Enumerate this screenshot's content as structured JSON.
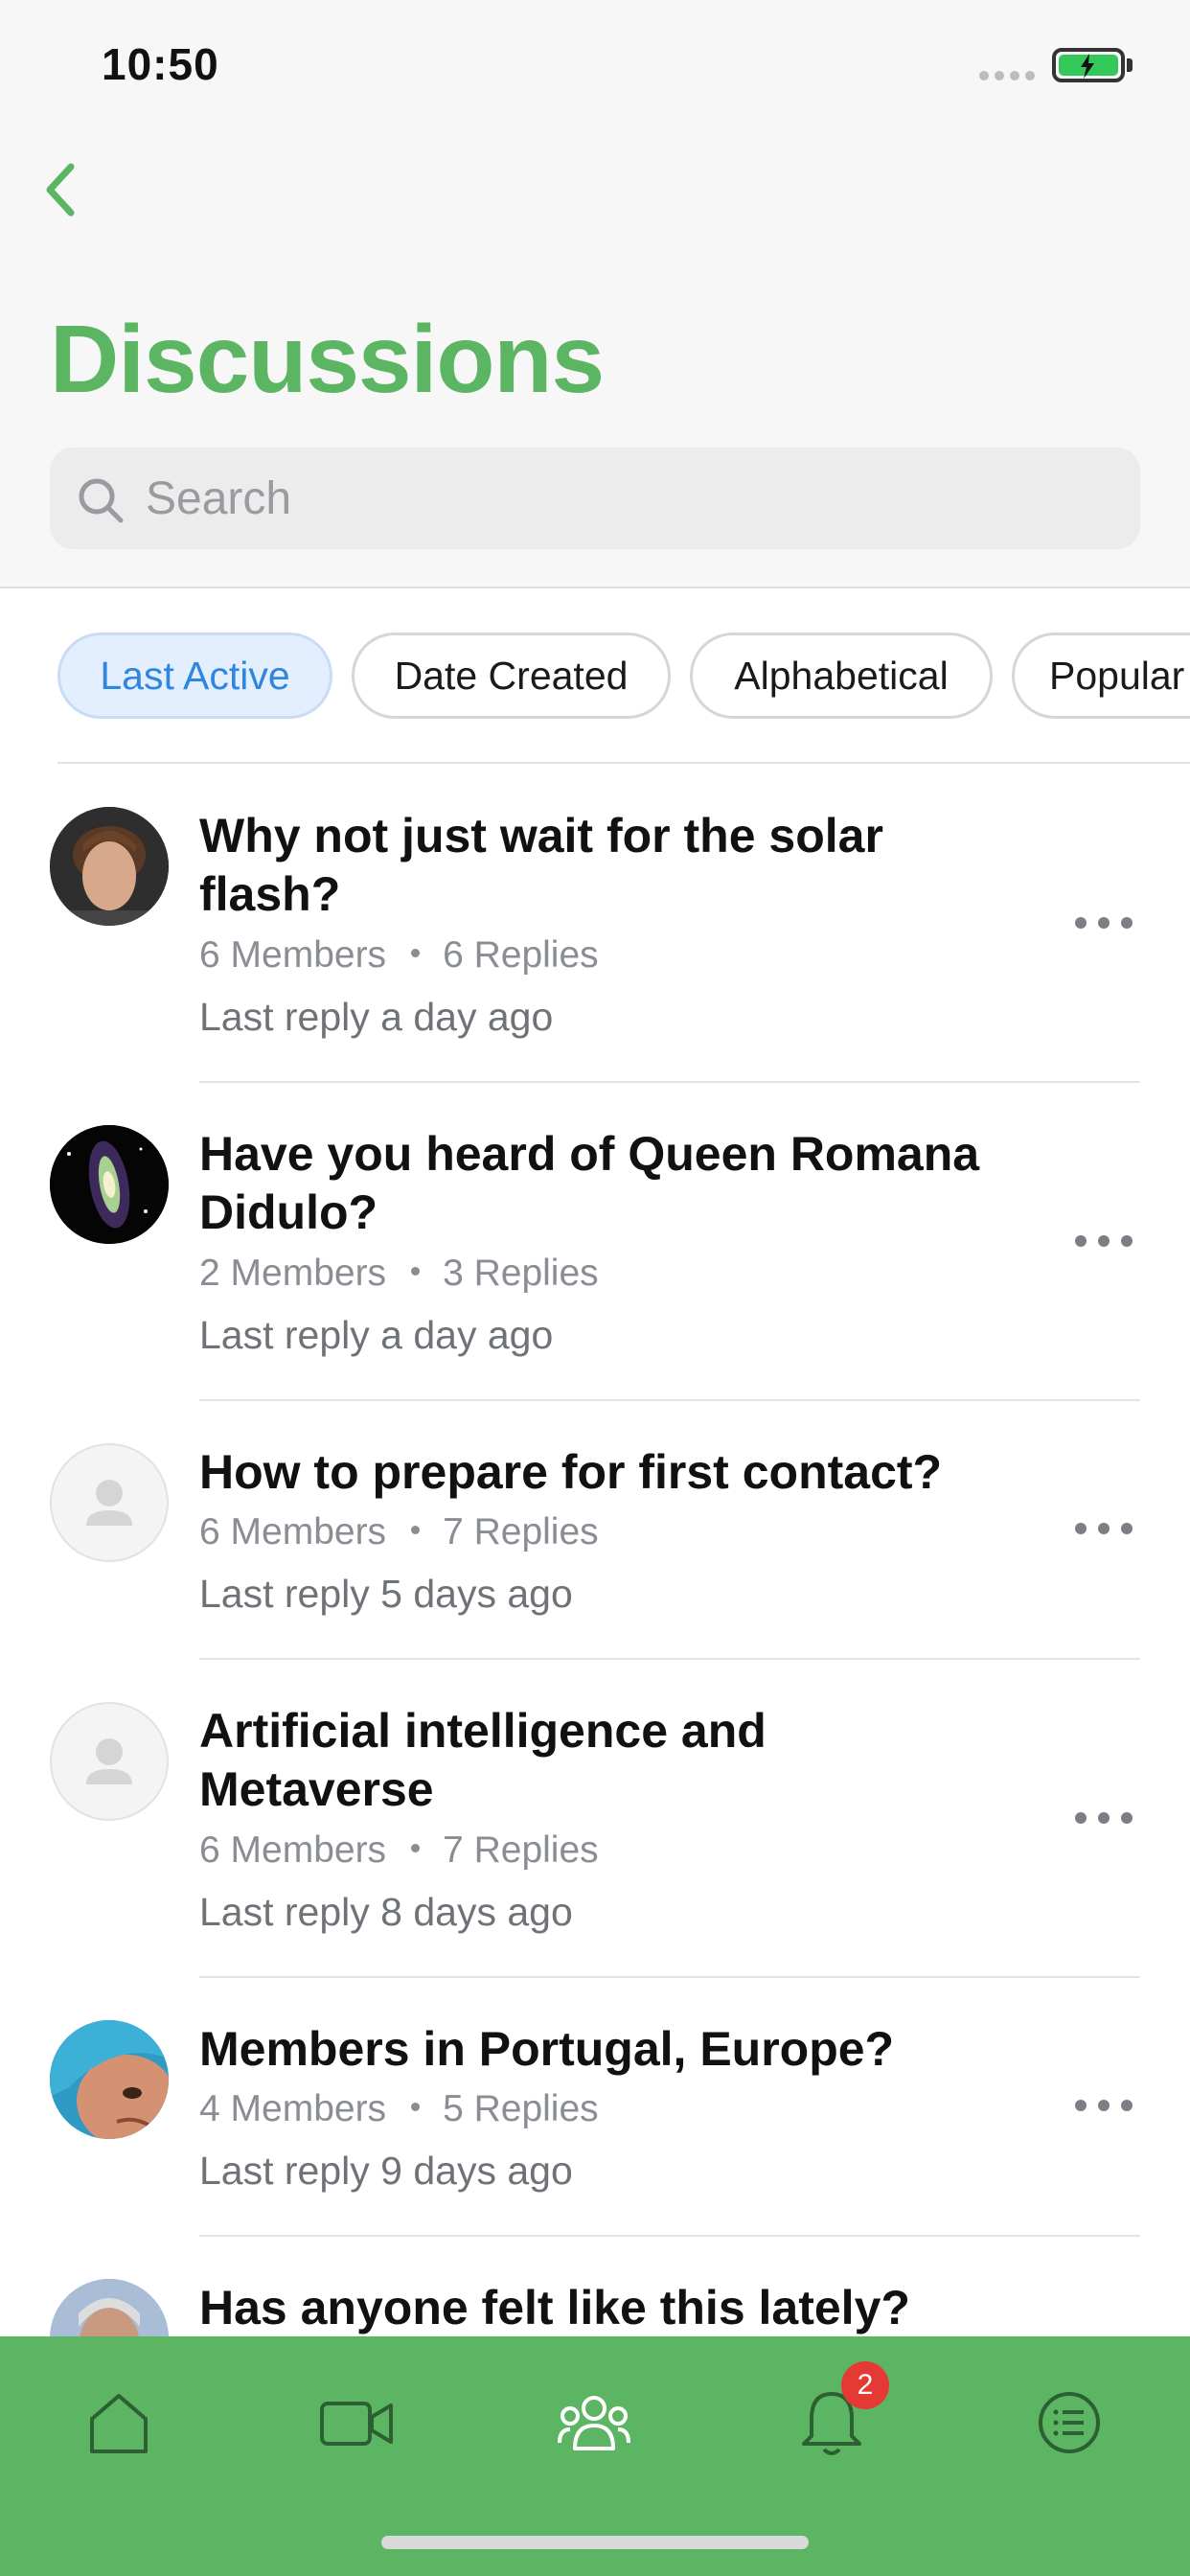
{
  "status_bar": {
    "time": "10:50"
  },
  "header": {
    "title": "Discussions"
  },
  "search": {
    "placeholder": "Search",
    "value": ""
  },
  "filters": [
    {
      "label": "Last Active",
      "active": true
    },
    {
      "label": "Date Created",
      "active": false
    },
    {
      "label": "Alphabetical",
      "active": false
    },
    {
      "label": "Popular",
      "active": false
    }
  ],
  "discussions": [
    {
      "title": "Why not just wait for the solar flash?",
      "members": "6 Members",
      "replies": "6 Replies",
      "last_reply": "Last reply a day ago",
      "avatar": "boy-portrait"
    },
    {
      "title": "Have you heard of Queen Romana Didulo?",
      "members": "2 Members",
      "replies": "3 Replies",
      "last_reply": "Last reply a day ago",
      "avatar": "galaxy-image"
    },
    {
      "title": "How to prepare for first contact?",
      "members": "6 Members",
      "replies": "7 Replies",
      "last_reply": "Last reply 5 days ago",
      "avatar": "default-user"
    },
    {
      "title": "Artificial intelligence and Metaverse",
      "members": "6 Members",
      "replies": "7 Replies",
      "last_reply": "Last reply 8 days ago",
      "avatar": "default-user"
    },
    {
      "title": "Members in Portugal, Europe?",
      "members": "4 Members",
      "replies": "5 Replies",
      "last_reply": "Last reply 9 days ago",
      "avatar": "face-closeup"
    },
    {
      "title": "Has anyone felt like this lately?",
      "avatar": "man-portrait"
    }
  ],
  "tab_bar": {
    "items": [
      "home-icon",
      "video-icon",
      "groups-icon",
      "notifications-icon",
      "menu-icon"
    ],
    "notification_badge": "2",
    "accent": "#5cb563"
  },
  "colors": {
    "brand_green": "#5cb563",
    "active_chip_text": "#2e86de",
    "active_chip_bg": "#e3efff",
    "badge": "#e53935"
  }
}
